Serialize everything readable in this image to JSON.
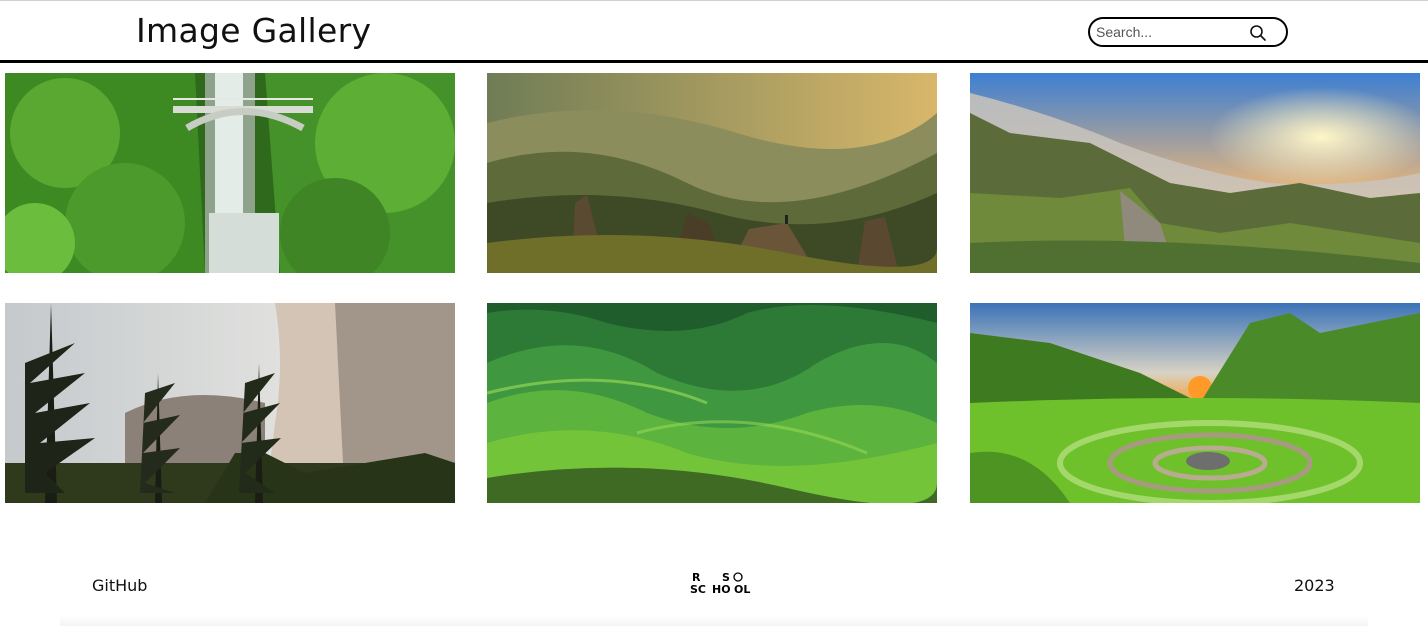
{
  "header": {
    "title": "Image Gallery",
    "search_placeholder": "Search..."
  },
  "gallery": {
    "images": [
      {
        "subject": "waterfall with arch bridge"
      },
      {
        "subject": "hiker on rock at golden hour in misty mountains"
      },
      {
        "subject": "green cliffs under sunset sky"
      },
      {
        "subject": "tall pine trees before granite cliff"
      },
      {
        "subject": "rolling green hills"
      },
      {
        "subject": "green valley with stone spiral at sunset"
      }
    ]
  },
  "footer": {
    "github_label": "GitHub",
    "logo_text": [
      "R",
      "S",
      "SC",
      "HO",
      "OL"
    ],
    "year": "2023"
  },
  "icons": {
    "search": "search-icon",
    "logo": "rs-school-logo"
  }
}
